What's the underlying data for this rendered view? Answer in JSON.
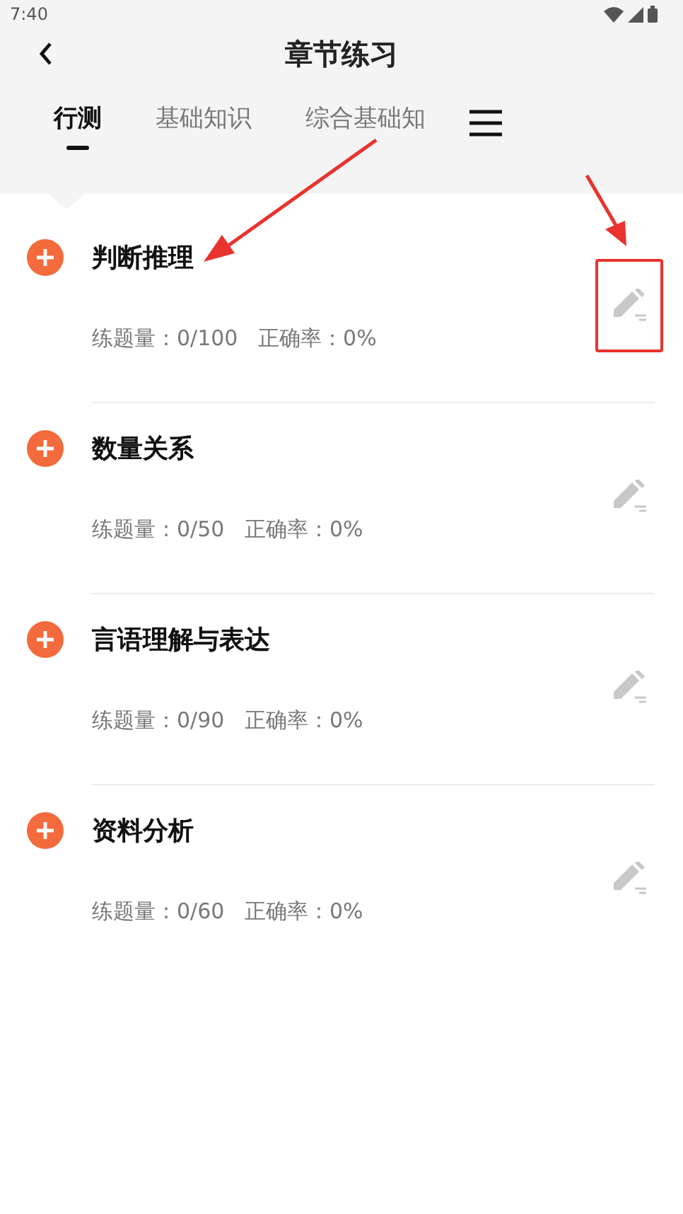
{
  "status_bar": {
    "time": "7:40"
  },
  "header": {
    "title": "章节练习"
  },
  "tabs": [
    {
      "label": "行测",
      "selected": true
    },
    {
      "label": "基础知识",
      "selected": false
    },
    {
      "label": "综合基础知",
      "selected": false
    }
  ],
  "chapters": [
    {
      "title": "判断推理",
      "stats": "练题量：0/100   正确率：0%",
      "highlighted": true
    },
    {
      "title": "数量关系",
      "stats": "练题量：0/50   正确率：0%",
      "highlighted": false
    },
    {
      "title": "言语理解与表达",
      "stats": "练题量：0/90   正确率：0%",
      "highlighted": false
    },
    {
      "title": "资料分析",
      "stats": "练题量：0/60   正确率：0%",
      "highlighted": false
    }
  ]
}
